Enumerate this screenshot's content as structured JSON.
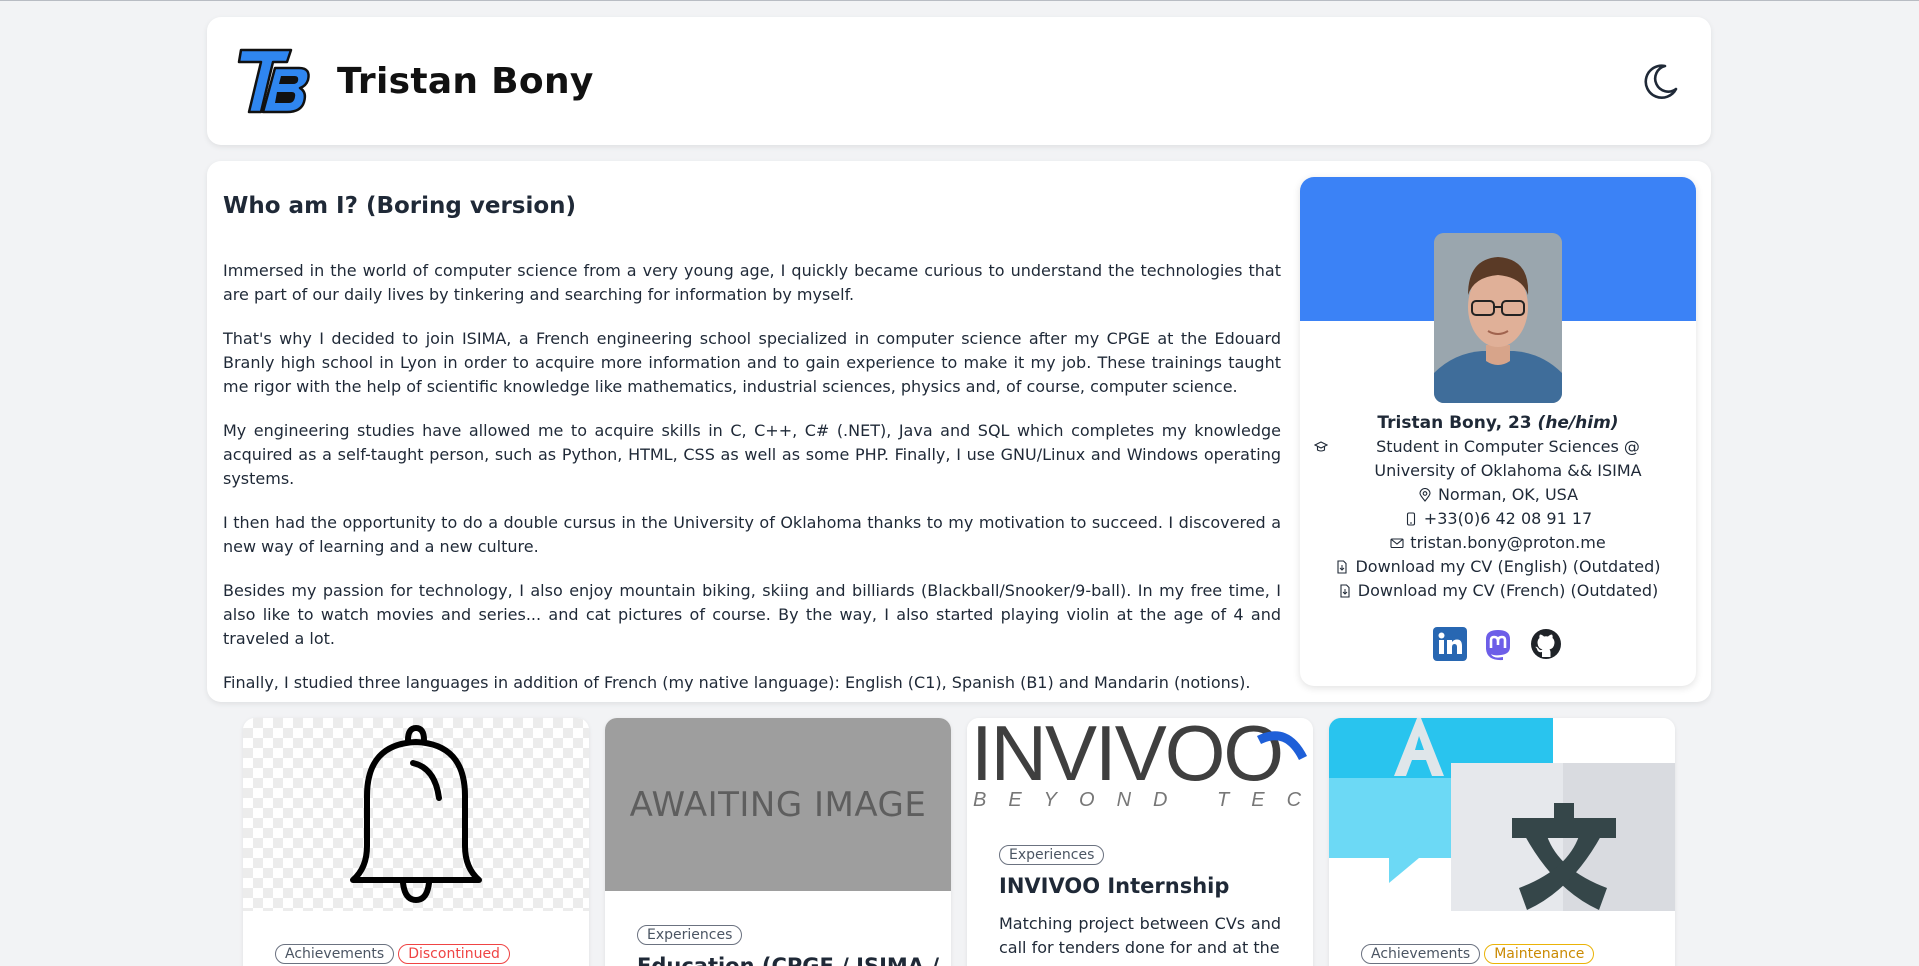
{
  "header": {
    "title": "Tristan Bony",
    "logo_icon": "tb-logo-icon",
    "theme_icon": "moon-icon"
  },
  "about": {
    "title": "Who am I? (Boring version)",
    "paragraphs": [
      "Immersed in the world of computer science from a very young age, I quickly became curious to understand the technologies that are part of our daily lives by tinkering and searching for information by myself.",
      "That's why I decided to join ISIMA, a French engineering school specialized in computer science after my CPGE at the Edouard Branly high school in Lyon in order to acquire more information and to gain experience to make it my job. These trainings taught me rigor with the help of scientific knowledge like mathematics, industrial sciences, physics and, of course, computer science.",
      "My engineering studies have allowed me to acquire skills in C, C++, C# (.NET), Java and SQL which completes my knowledge acquired as a self-taught person, such as Python, HTML, CSS as well as some PHP. Finally, I use GNU/Linux and Windows operating systems.",
      "I then had the opportunity to do a double cursus in the University of Oklahoma thanks to my motivation to succeed. I discovered a new way of learning and a new culture.",
      "Besides my passion for technology, I also enjoy mountain biking, skiing and billiards (Blackball/Snooker/9-ball). In my free time, I also like to watch movies and series... and cat pictures of course. By the way, I also started playing violin at the age of 4 and traveled a lot.",
      "Finally, I studied three languages in addition of French (my native language): English (C1), Spanish (B1) and Mandarin (notions)."
    ]
  },
  "profile": {
    "name": "Tristan Bony, 23",
    "pronouns": "(he/him)",
    "study": "Student in Computer Sciences @ University of Oklahoma && ISIMA",
    "location": "Norman, OK, USA",
    "phone": "+33(0)6 42 08 91 17",
    "email": "tristan.bony@proton.me",
    "cv_en": "Download my CV (English) (Outdated)",
    "cv_fr": "Download my CV (French) (Outdated)",
    "banner_color": "#3b82f6",
    "socials": [
      "linkedin-icon",
      "mastodon-icon",
      "github-icon"
    ]
  },
  "cards": [
    {
      "image": "bell-icon",
      "tags": [
        "Achievements",
        "Discontinued"
      ]
    },
    {
      "image_text": "AWAITING IMAGE",
      "tags": [
        "Experiences"
      ],
      "title": "Education (CPGE / ISIMA /"
    },
    {
      "logo_text": "INVIVOO",
      "logo_sub": "BEYOND TECH",
      "tags": [
        "Experiences"
      ],
      "title": "INVIVOO Internship",
      "desc": "Matching project between CVs and call for tenders done for and at the"
    },
    {
      "image": "translate-icon",
      "tags": [
        "Achievements",
        "Maintenance"
      ]
    }
  ]
}
